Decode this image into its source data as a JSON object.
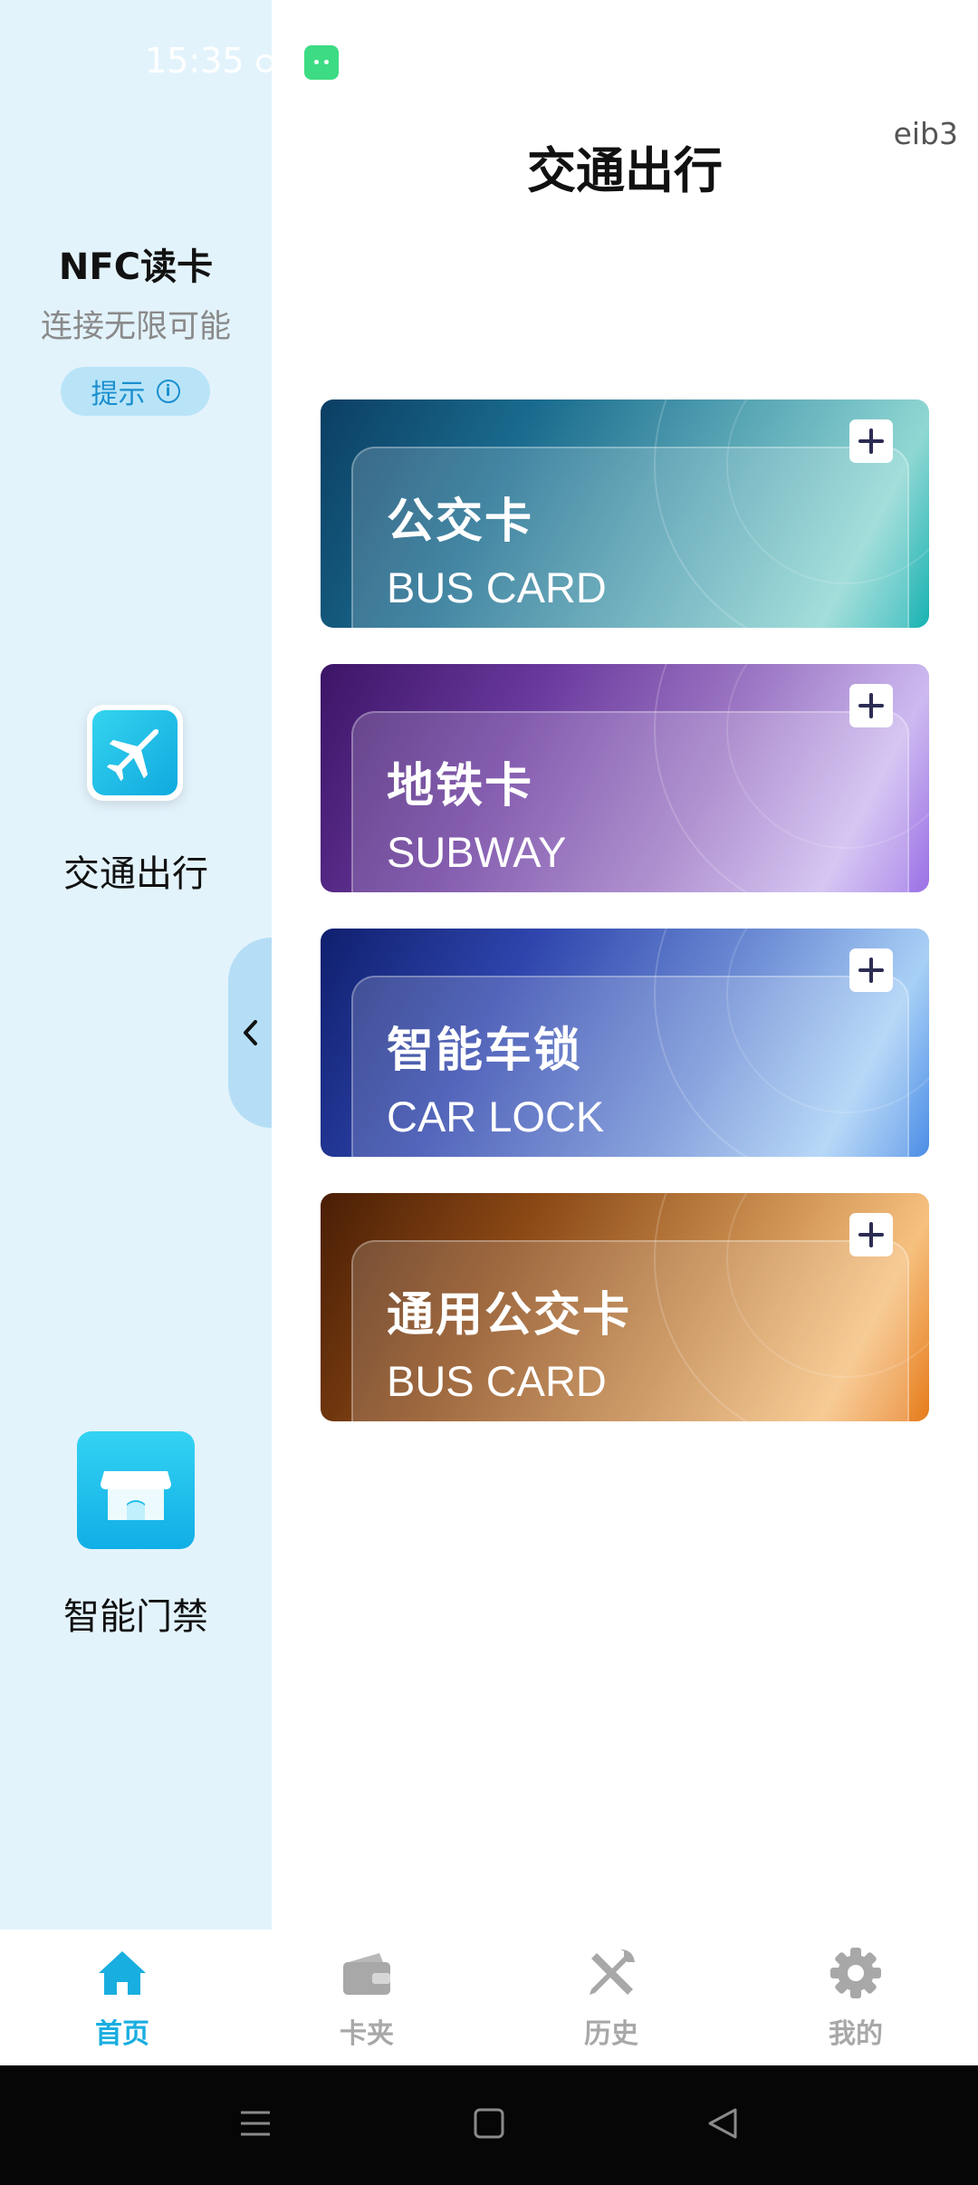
{
  "status_bar": {
    "time": "15:35"
  },
  "sidebar": {
    "nfc_title": "NFC读卡",
    "nfc_subtitle": "连接无限可能",
    "hint_label": "提示",
    "items": [
      {
        "label": "交通出行",
        "icon": "airplane-icon"
      },
      {
        "label": "智能门禁",
        "icon": "storefront-icon"
      }
    ]
  },
  "header": {
    "title": "交通出行",
    "user_code": "eib3"
  },
  "cards": [
    {
      "title_cn": "公交卡",
      "title_en": "BUS CARD"
    },
    {
      "title_cn": "地铁卡",
      "title_en": "SUBWAY"
    },
    {
      "title_cn": "智能车锁",
      "title_en": "CAR LOCK"
    },
    {
      "title_cn": "通用公交卡",
      "title_en": "BUS CARD"
    }
  ],
  "bottom_nav": [
    {
      "label": "首页",
      "icon": "home-icon",
      "active": true
    },
    {
      "label": "卡夹",
      "icon": "wallet-icon",
      "active": false
    },
    {
      "label": "历史",
      "icon": "tools-icon",
      "active": false
    },
    {
      "label": "我的",
      "icon": "gear-icon",
      "active": false
    }
  ],
  "colors": {
    "accent": "#19aee0",
    "sidebar_bg": "#e3f3fc",
    "inactive_nav": "#a8a8a8"
  }
}
